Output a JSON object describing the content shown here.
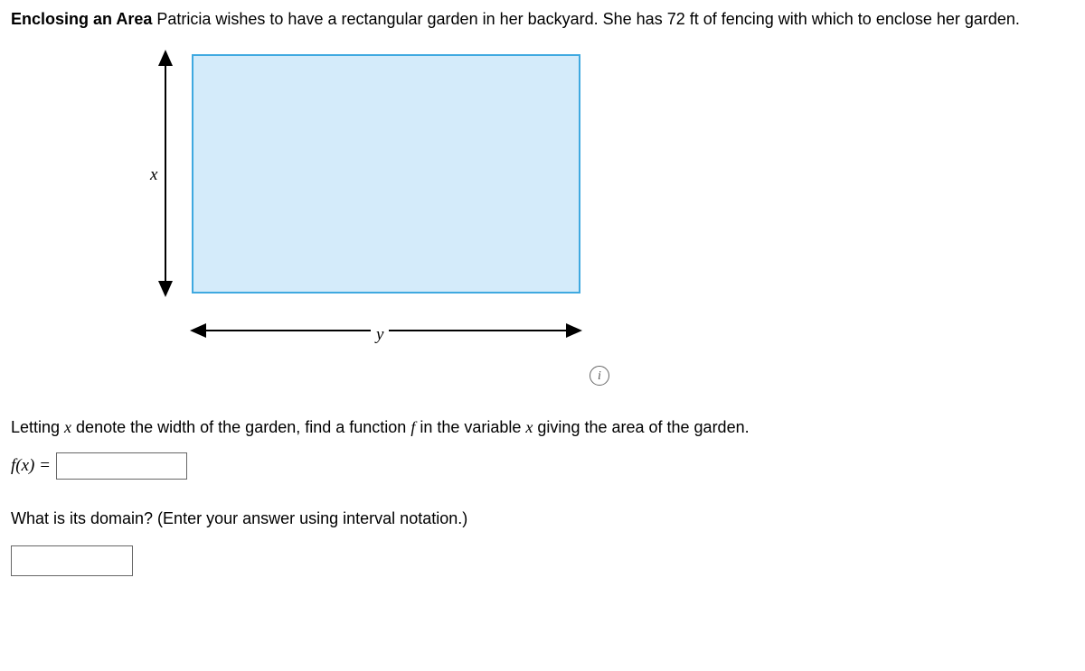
{
  "problem": {
    "title": "Enclosing an Area",
    "text_part_1": "   Patricia wishes to have a rectangular garden in her backyard. She has 72 ft of fencing with which to enclose her garden."
  },
  "diagram": {
    "x_label": "x",
    "y_label": "y"
  },
  "question_1": {
    "prefix": "Letting ",
    "var1": "x",
    "mid1": " denote the width of the garden, find a function ",
    "var2": "f",
    "mid2": " in the variable ",
    "var3": "x",
    "suffix": " giving the area of the garden."
  },
  "fx_label": {
    "f": "f",
    "open": "(",
    "x": "x",
    "close": ") ="
  },
  "question_2": {
    "text": "What is its domain? (Enter your answer using interval notation.)"
  }
}
